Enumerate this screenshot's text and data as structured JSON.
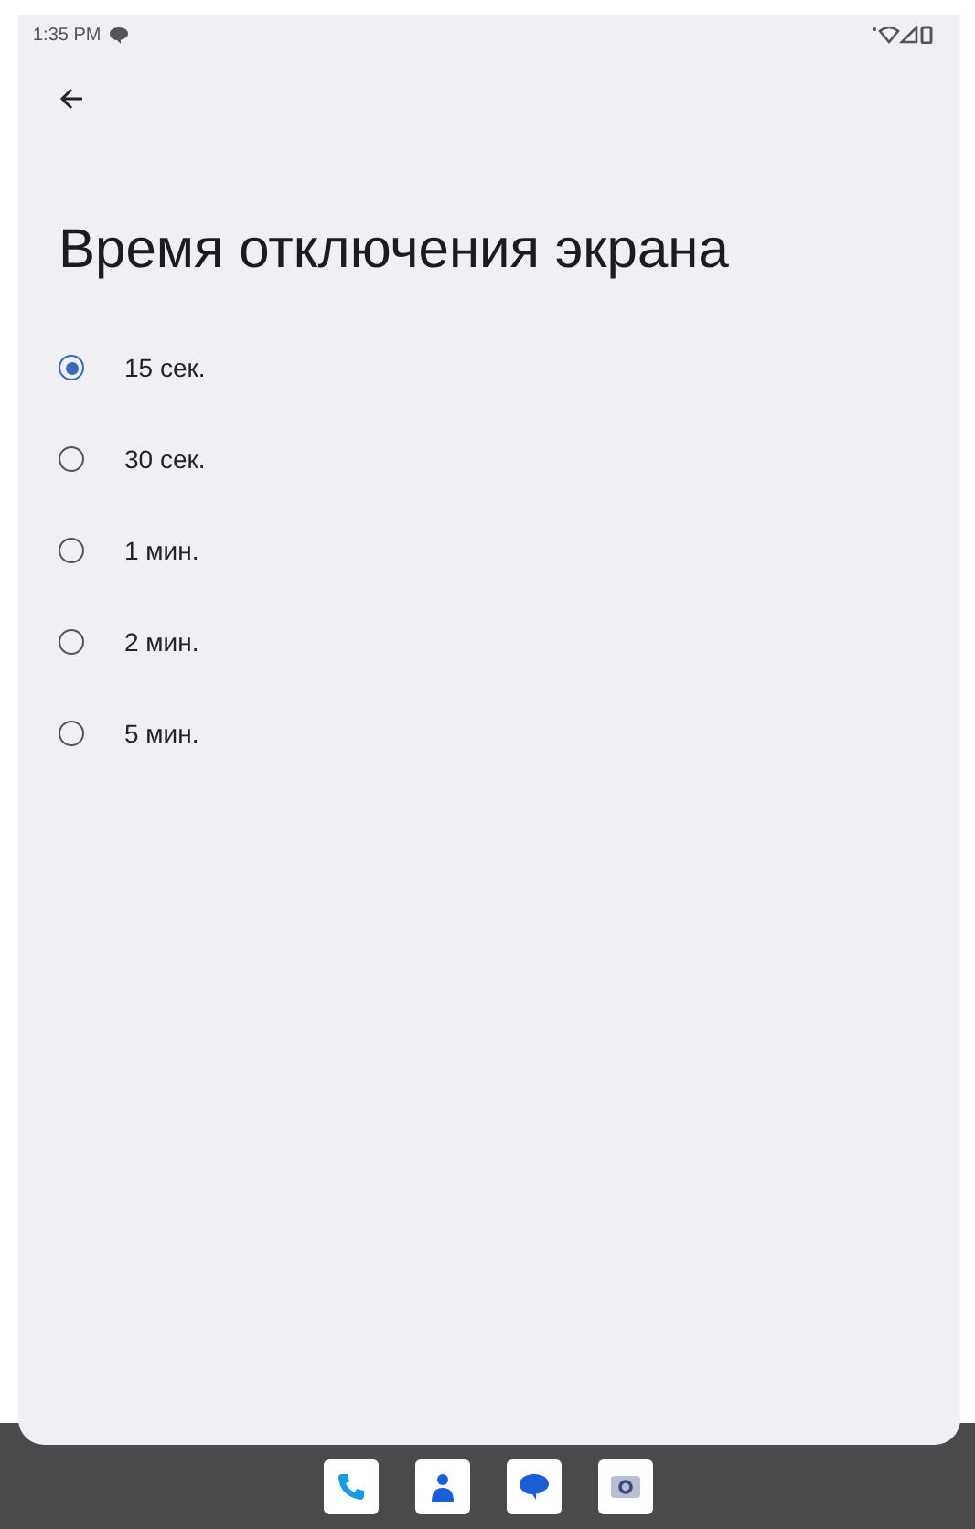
{
  "status_bar": {
    "time": "1:35 PM"
  },
  "title": "Время отключения экрана",
  "options": [
    {
      "label": "15 сек.",
      "selected": true
    },
    {
      "label": "30 сек.",
      "selected": false
    },
    {
      "label": "1 мин.",
      "selected": false
    },
    {
      "label": "2 мин.",
      "selected": false
    },
    {
      "label": "5 мин.",
      "selected": false
    }
  ],
  "taskbar": [
    {
      "kind": "phone"
    },
    {
      "kind": "contacts"
    },
    {
      "kind": "messages"
    },
    {
      "kind": "camera"
    }
  ]
}
